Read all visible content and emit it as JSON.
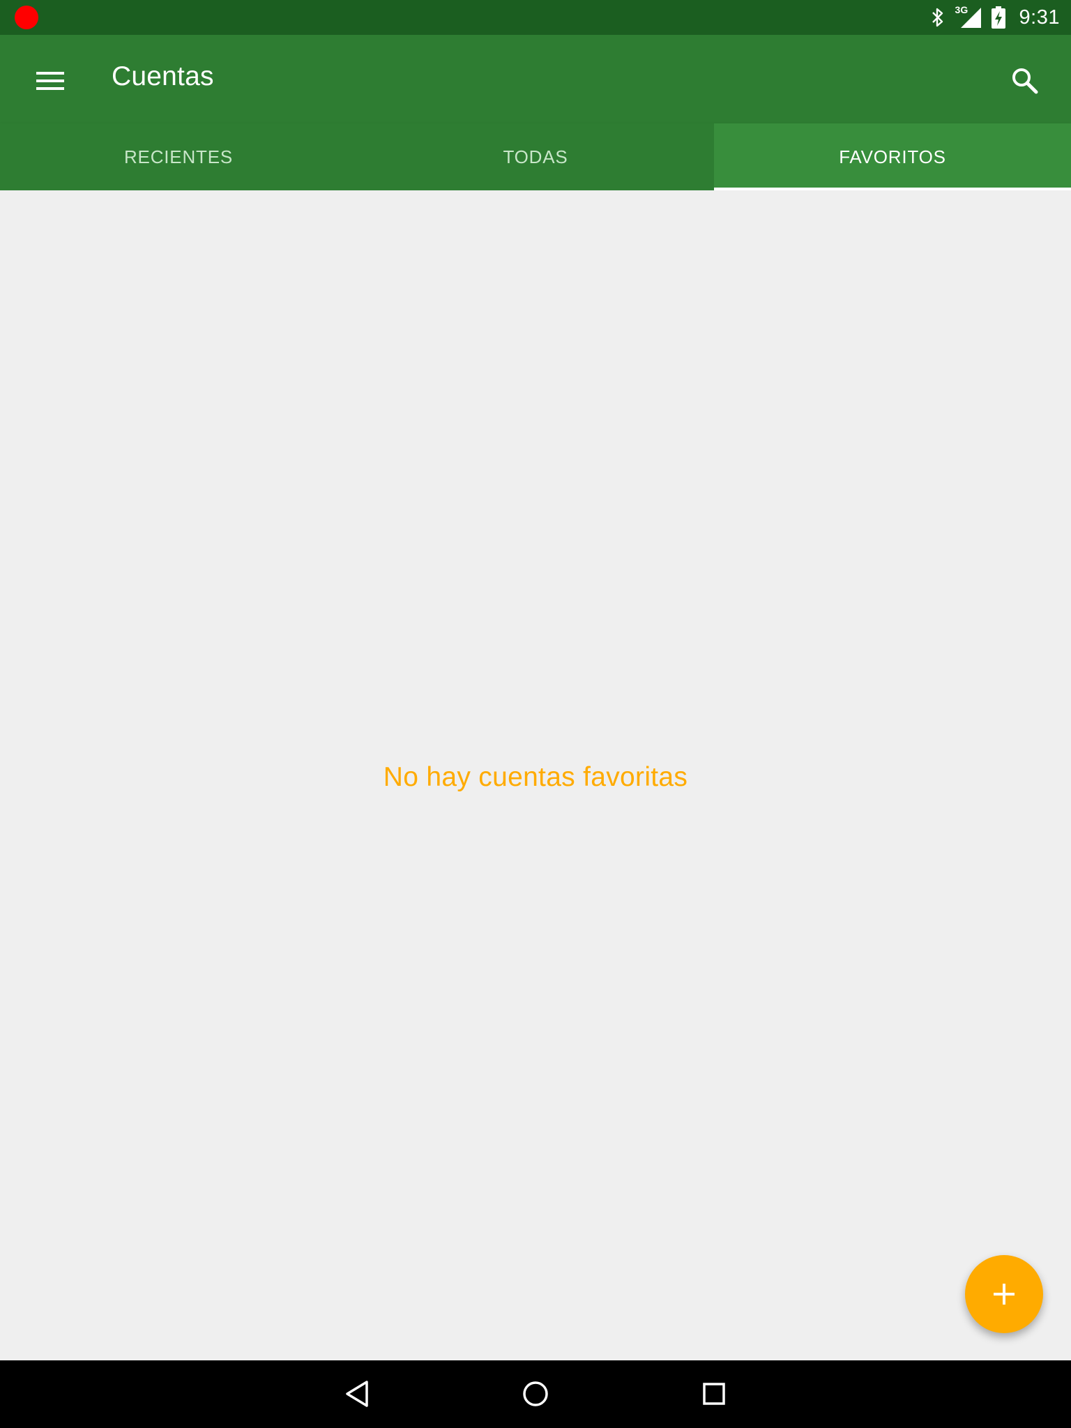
{
  "status_bar": {
    "network_label": "3G",
    "time": "9:31"
  },
  "app_bar": {
    "title": "Cuentas",
    "menu_icon": "hamburger-menu-icon",
    "search_icon": "search-icon"
  },
  "tabs": [
    {
      "label": "RECIENTES",
      "active": false
    },
    {
      "label": "TODAS",
      "active": false
    },
    {
      "label": "FAVORITOS",
      "active": true
    }
  ],
  "content": {
    "empty_message": "No hay cuentas favoritas"
  },
  "fab": {
    "icon": "plus-icon"
  },
  "navigation": {
    "back_icon": "back-icon",
    "home_icon": "home-icon",
    "recents_icon": "recents-icon"
  },
  "colors": {
    "status_bar": "#1b5e20",
    "primary": "#2e7d32",
    "accent": "#ffab00",
    "background": "#efefef"
  }
}
